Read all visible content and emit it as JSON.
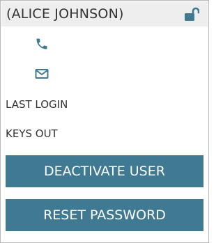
{
  "header": {
    "user_name": "(ALICE JOHNSON)",
    "lock_icon": "unlocked-padlock"
  },
  "contact": {
    "phone_icon": "phone",
    "mail_icon": "envelope"
  },
  "info": {
    "last_login_label": "LAST LOGIN",
    "keys_out_label": "KEYS OUT"
  },
  "actions": {
    "deactivate_label": "DEACTIVATE USER",
    "reset_password_label": "RESET PASSWORD"
  },
  "colors": {
    "accent": "#3f7a92",
    "header_bg": "#eeeeee",
    "text": "#333333"
  }
}
